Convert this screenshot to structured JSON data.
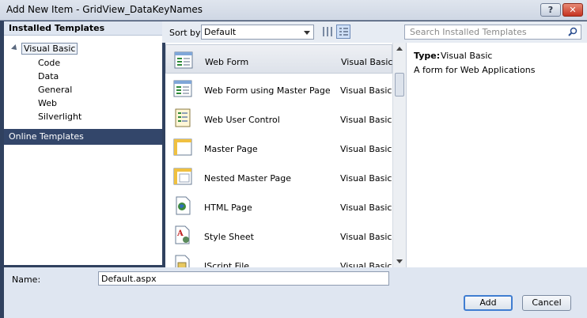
{
  "window": {
    "title": "Add New Item - GridView_DataKeyNames",
    "help_label": "?",
    "close_label": "✕"
  },
  "left_panel": {
    "header": "Installed Templates",
    "tree": [
      {
        "label": "Visual Basic",
        "level": 0,
        "selected": true
      },
      {
        "label": "Code",
        "level": 1
      },
      {
        "label": "Data",
        "level": 1
      },
      {
        "label": "General",
        "level": 1
      },
      {
        "label": "Web",
        "level": 1
      },
      {
        "label": "Silverlight",
        "level": 1
      }
    ],
    "online": "Online Templates"
  },
  "toolbar": {
    "sort_label": "Sort by:",
    "sort_value": "Default",
    "search_placeholder": "Search Installed Templates"
  },
  "templates": [
    {
      "name": "Web Form",
      "lang": "Visual Basic",
      "icon": "web-form-icon",
      "selected": true
    },
    {
      "name": "Web Form using Master Page",
      "lang": "Visual Basic",
      "icon": "web-form-master-icon"
    },
    {
      "name": "Web User Control",
      "lang": "Visual Basic",
      "icon": "user-control-icon"
    },
    {
      "name": "Master Page",
      "lang": "Visual Basic",
      "icon": "master-page-icon"
    },
    {
      "name": "Nested Master Page",
      "lang": "Visual Basic",
      "icon": "nested-master-page-icon"
    },
    {
      "name": "HTML Page",
      "lang": "Visual Basic",
      "icon": "html-page-icon"
    },
    {
      "name": "Style Sheet",
      "lang": "Visual Basic",
      "icon": "style-sheet-icon"
    },
    {
      "name": "JScript File",
      "lang": "Visual Basic",
      "icon": "jscript-file-icon"
    }
  ],
  "details": {
    "type_label": "Type:",
    "type_value": "Visual Basic",
    "description": "A form for Web Applications"
  },
  "name_field": {
    "label": "Name:",
    "value": "Default.aspx"
  },
  "buttons": {
    "add": "Add",
    "cancel": "Cancel"
  }
}
